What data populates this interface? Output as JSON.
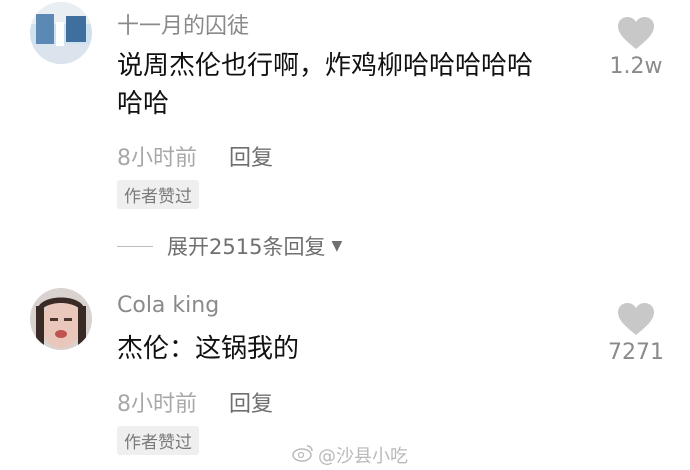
{
  "comments": [
    {
      "username": "十一月的囚徒",
      "text_line1": "说周杰伦也行啊，炸鸡柳哈哈哈哈哈",
      "text_line2": "哈哈",
      "time": "8小时前",
      "reply_label": "回复",
      "badge": "作者赞过",
      "likes": "1.2w"
    },
    {
      "username": "Cola king",
      "text_line1": "杰伦：这锅我的",
      "time": "8小时前",
      "reply_label": "回复",
      "badge": "作者赞过",
      "likes": "7271"
    }
  ],
  "expand_replies": "展开2515条回复",
  "watermark": "@沙县小吃",
  "colors": {
    "heart": "#c8c8c8",
    "muted_text": "#8a8a8a"
  }
}
